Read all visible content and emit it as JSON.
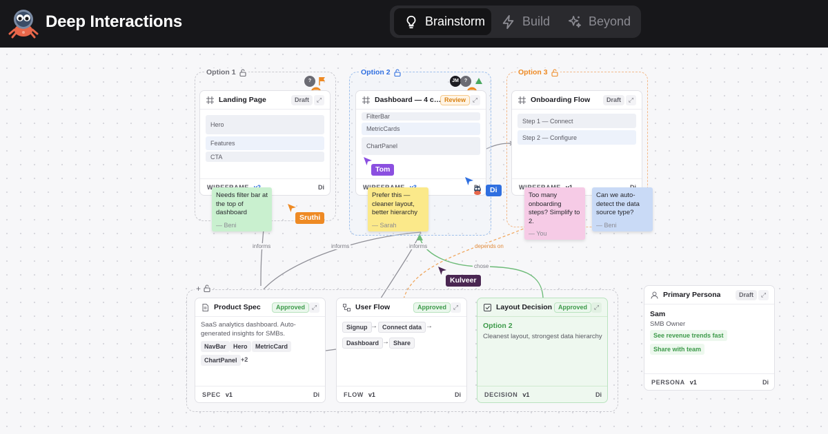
{
  "app": {
    "title": "Deep Interactions"
  },
  "modes": [
    {
      "label": "Brainstorm",
      "icon": "lightbulb-icon",
      "active": true
    },
    {
      "label": "Build",
      "icon": "lightning-icon",
      "active": false
    },
    {
      "label": "Beyond",
      "icon": "sparkles-icon",
      "active": false
    }
  ],
  "options": [
    {
      "label": "Option 1",
      "card": {
        "title": "Landing Page",
        "status": "Draft",
        "blocks": [
          "Hero",
          "Features",
          "CTA"
        ],
        "footer": "WIREFRAME",
        "version": "v2",
        "owner": "Di"
      }
    },
    {
      "label": "Option 2",
      "card": {
        "title": "Dashboard — 4 ca...",
        "status": "Review",
        "blocks": [
          "FilterBar",
          "MetricCards",
          "ChartPanel"
        ],
        "footer": "WIREFRAME",
        "version": "v3",
        "owner": "Di"
      },
      "avatars": [
        "JM",
        "?"
      ]
    },
    {
      "label": "Option 3",
      "card": {
        "title": "Onboarding Flow",
        "status": "Draft",
        "blocks": [
          "Step 1 — Connect",
          "Step 2 — Configure"
        ],
        "footer": "WIREFRAME",
        "version": "v1",
        "owner": "Di"
      }
    }
  ],
  "option1_avatar": "?",
  "stickies": [
    {
      "text": "Needs filter bar at the top of dashboard",
      "author": "— Beni",
      "color": "#c9f0cf"
    },
    {
      "text": "Prefer this — cleaner layout, better hierarchy",
      "author": "— Sarah",
      "color": "#fbe98a"
    },
    {
      "text": "Too many onboarding steps? Simplify to 2.",
      "author": "— You",
      "color": "#f6cbe6"
    },
    {
      "text": "Can we auto-detect the data source type?",
      "author": "— Beni",
      "color": "#c9daf6"
    }
  ],
  "cursors": [
    {
      "name": "Tom",
      "color": "#8b4fe0"
    },
    {
      "name": "Di",
      "color": "#2f6fe0"
    },
    {
      "name": "Sruthi",
      "color": "#ee8a24"
    },
    {
      "name": "Kulveer",
      "color": "#4a2652"
    }
  ],
  "edges": [
    "informs",
    "informs",
    "informs",
    "depends on",
    "chose"
  ],
  "bottom": {
    "spec": {
      "title": "Product Spec",
      "status": "Approved",
      "description": "SaaS analytics dashboard. Auto-generated insights for SMBs.",
      "chips": [
        "NavBar",
        "Hero",
        "MetricCard",
        "ChartPanel"
      ],
      "more": "+2",
      "footer": "SPEC",
      "version": "v1",
      "owner": "Di"
    },
    "flow": {
      "title": "User Flow",
      "status": "Approved",
      "steps": [
        "Signup",
        "Connect data",
        "Dashboard",
        "Share"
      ],
      "arrow": "→",
      "footer": "FLOW",
      "version": "v1",
      "owner": "Di"
    },
    "decision": {
      "title": "Layout Decision",
      "status": "Approved",
      "choice": "Option 2",
      "reason": "Cleanest layout, strongest data hierarchy",
      "footer": "DECISION",
      "version": "v1",
      "owner": "Di"
    }
  },
  "persona": {
    "title": "Primary Persona",
    "status": "Draft",
    "name": "Sam",
    "role": "SMB Owner",
    "goals": [
      "See revenue trends fast",
      "Share with team"
    ],
    "footer": "PERSONA",
    "version": "v1",
    "owner": "Di"
  },
  "colors": {
    "accent_blue": "#2f6fe0",
    "accent_orange": "#ee8a24",
    "approved_green": "#3d9a4a",
    "topbar": "#17171a"
  }
}
